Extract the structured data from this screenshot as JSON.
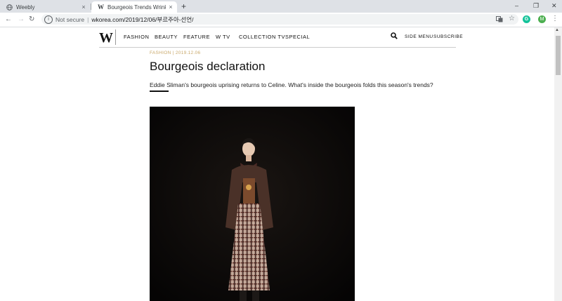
{
  "browser": {
    "tabs": [
      {
        "title": "Weebly",
        "active": false
      },
      {
        "title": "Bourgeois Trends Wrinkle the Tre",
        "active": true
      }
    ],
    "new_tab_symbol": "+",
    "close_symbol": "×",
    "window_controls": {
      "minimize": "–",
      "maximize": "❐",
      "close": "✕"
    },
    "nav": {
      "back": "←",
      "forward": "→",
      "reload": "↻"
    },
    "address": {
      "security_label": "Not secure",
      "url": "wkorea.com/2019/12/06/부르주아-선언/"
    },
    "profile_initial": "M",
    "extension_initial": "G"
  },
  "site": {
    "logo": "W",
    "nav_items": [
      "FASHION",
      "BEAUTY",
      "FEATURE",
      "W TV",
      "COLLECTION TV",
      "SPECIAL"
    ],
    "right_items": [
      "SIDE MENU",
      "SUBSCRIBE"
    ]
  },
  "article": {
    "category": "FASHION",
    "date": "2019.12.06",
    "title": "Bourgeois declaration",
    "deck": "Eddie Sliman's bourgeois uprising returns to Celine. What's inside the bourgeois folds this season's trends?"
  },
  "colors": {
    "accent_gold": "#c9a86a",
    "photo_bg": "#0b0908",
    "tabstrip": "#dee1e6"
  }
}
